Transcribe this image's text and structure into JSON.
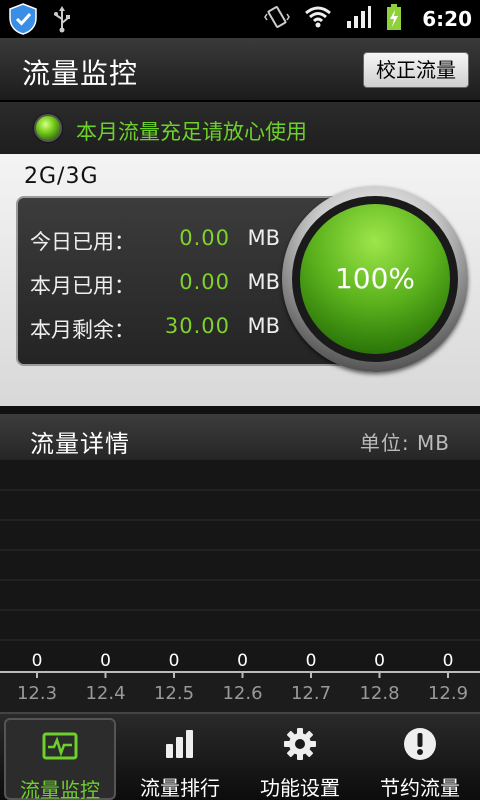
{
  "status_bar": {
    "time": "6:20",
    "icons": [
      "shield-check-icon",
      "usb-icon",
      "vibrate-icon",
      "wifi-icon",
      "signal-icon",
      "battery-charging-icon"
    ]
  },
  "header": {
    "title": "流量监控",
    "calibrate_button": "校正流量"
  },
  "status_message": "本月流量充足请放心使用",
  "panel": {
    "network_type": "2G/3G",
    "stats": [
      {
        "label": "今日已用：",
        "value": "0.00",
        "unit": "MB"
      },
      {
        "label": "本月已用：",
        "value": "0.00",
        "unit": "MB"
      },
      {
        "label": "本月剩余：",
        "value": "30.00",
        "unit": "MB"
      }
    ],
    "gauge_text": "100%",
    "gauge_level": 1.0
  },
  "detail": {
    "title": "流量详情",
    "unit_label": "单位: MB"
  },
  "chart_data": {
    "type": "bar",
    "categories": [
      "12.3",
      "12.4",
      "12.5",
      "12.6",
      "12.7",
      "12.8",
      "12.9"
    ],
    "values": [
      0,
      0,
      0,
      0,
      0,
      0,
      0
    ],
    "data_labels": [
      "0",
      "0",
      "0",
      "0",
      "0",
      "0",
      "0"
    ],
    "title": "",
    "xlabel": "",
    "ylabel": "",
    "grid": true
  },
  "tabs": [
    {
      "label": "流量监控",
      "icon": "monitor-icon",
      "active": true
    },
    {
      "label": "流量排行",
      "icon": "bar-chart-icon",
      "active": false
    },
    {
      "label": "功能设置",
      "icon": "gear-icon",
      "active": false
    },
    {
      "label": "节约流量",
      "icon": "exclamation-icon",
      "active": false
    }
  ],
  "colors": {
    "accent_green": "#6cd12a",
    "value_green": "#7fd32a"
  }
}
